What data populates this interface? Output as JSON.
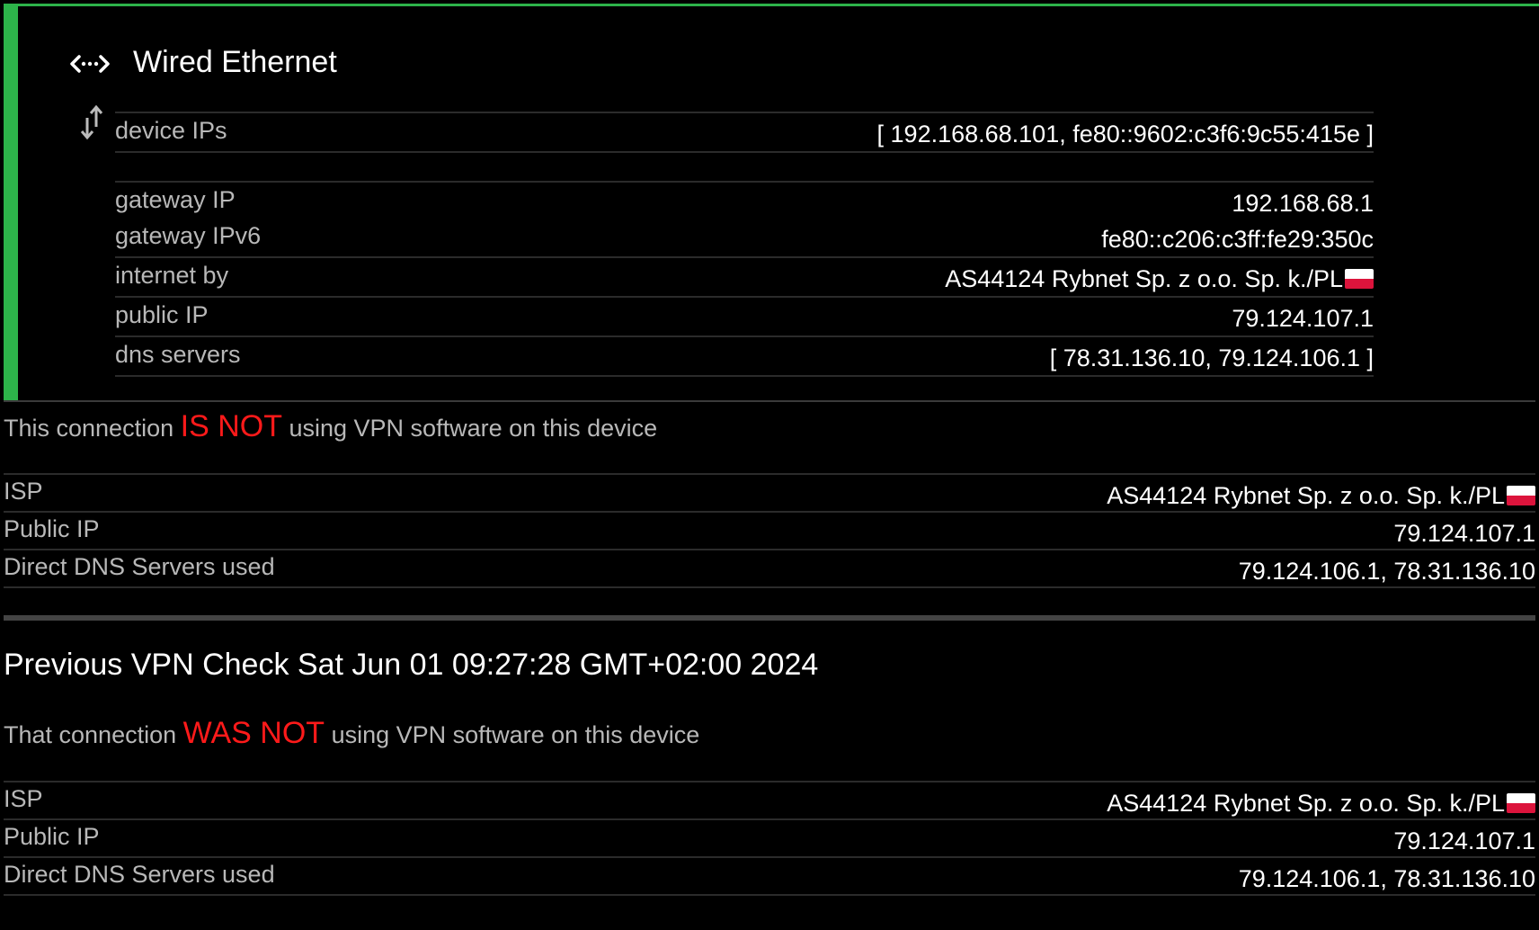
{
  "network": {
    "title": "Wired Ethernet",
    "icons": {
      "type": "ethernet-icon",
      "transfer": "transfer-arrows-icon"
    },
    "accent_color": "#2db34a",
    "details": [
      {
        "label": "device IPs",
        "value": "[ 192.168.68.101, fe80::9602:c3f6:9c55:415e ]"
      },
      {
        "label": "gateway IP",
        "value": "192.168.68.1"
      },
      {
        "label": "gateway IPv6",
        "value": "fe80::c206:c3ff:fe29:350c"
      },
      {
        "label": "internet by",
        "value": "AS44124 Rybnet Sp. z o.o. Sp. k./PL"
      },
      {
        "label": "public IP",
        "value": "79.124.107.1"
      },
      {
        "label": "dns servers",
        "value": "[ 78.31.136.10, 79.124.106.1 ]"
      }
    ]
  },
  "current": {
    "status_prefix": "This connection",
    "status_highlight": "IS NOT",
    "status_suffix": "using VPN software on this device",
    "highlight_color": "#ff1a1a",
    "rows": [
      {
        "label": "ISP",
        "value": "AS44124 Rybnet Sp. z o.o. Sp. k./PL"
      },
      {
        "label": "Public IP",
        "value": "79.124.107.1"
      },
      {
        "label": "Direct DNS Servers used",
        "value": "79.124.106.1, 78.31.136.10"
      }
    ]
  },
  "previous": {
    "title": "Previous VPN Check Sat Jun 01 09:27:28 GMT+02:00 2024",
    "status_prefix": "That connection",
    "status_highlight": "WAS NOT",
    "status_suffix": "using VPN software on this device",
    "rows": [
      {
        "label": "ISP",
        "value": "AS44124 Rybnet Sp. z o.o. Sp. k./PL"
      },
      {
        "label": "Public IP",
        "value": "79.124.107.1"
      },
      {
        "label": "Direct DNS Servers used",
        "value": "79.124.106.1, 78.31.136.10"
      }
    ]
  }
}
